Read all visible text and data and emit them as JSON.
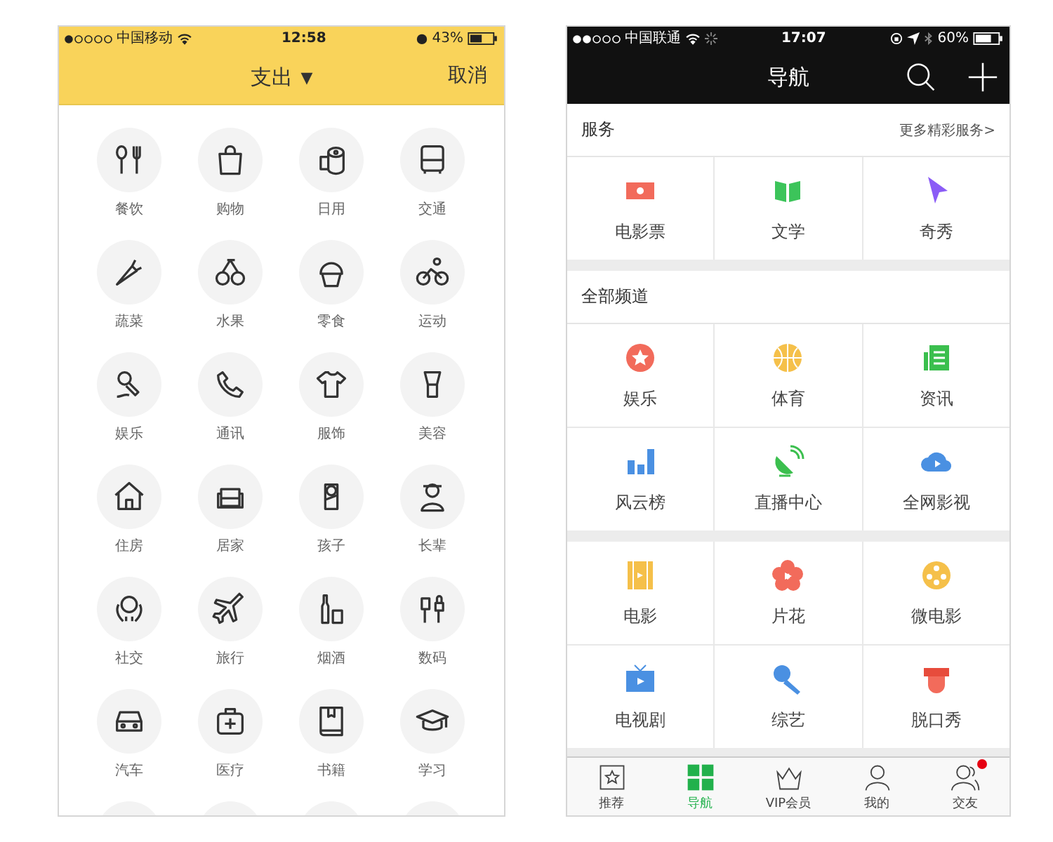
{
  "left_phone": {
    "status_bar": {
      "carrier": "中国移动",
      "time": "12:58",
      "battery": "43%"
    },
    "header": {
      "title": "支出",
      "dropdown_arrow": "▼",
      "cancel": "取消"
    },
    "categories": [
      {
        "label": "餐饮"
      },
      {
        "label": "购物"
      },
      {
        "label": "日用"
      },
      {
        "label": "交通"
      },
      {
        "label": "蔬菜"
      },
      {
        "label": "水果"
      },
      {
        "label": "零食"
      },
      {
        "label": "运动"
      },
      {
        "label": "娱乐"
      },
      {
        "label": "通讯"
      },
      {
        "label": "服饰"
      },
      {
        "label": "美容"
      },
      {
        "label": "住房"
      },
      {
        "label": "居家"
      },
      {
        "label": "孩子"
      },
      {
        "label": "长辈"
      },
      {
        "label": "社交"
      },
      {
        "label": "旅行"
      },
      {
        "label": "烟酒"
      },
      {
        "label": "数码"
      },
      {
        "label": "汽车"
      },
      {
        "label": "医疗"
      },
      {
        "label": "书籍"
      },
      {
        "label": "学习"
      },
      {
        "cut": true
      },
      {
        "cut": true
      },
      {
        "cut": true
      },
      {
        "cut": true
      }
    ]
  },
  "right_phone": {
    "status_bar": {
      "carrier": "中国联通",
      "time": "17:07",
      "battery": "60%"
    },
    "header": {
      "title": "导航"
    },
    "sections": [
      {
        "title": "服务",
        "more": "更多精彩服务>",
        "groups": [
          [
            {
              "label": "电影票"
            },
            {
              "label": "文学"
            },
            {
              "label": "奇秀"
            }
          ]
        ]
      },
      {
        "title": "全部频道",
        "groups": [
          [
            {
              "label": "娱乐"
            },
            {
              "label": "体育"
            },
            {
              "label": "资讯"
            },
            {
              "label": "风云榜"
            },
            {
              "label": "直播中心"
            },
            {
              "label": "全网影视"
            }
          ],
          [
            {
              "label": "电影"
            },
            {
              "label": "片花"
            },
            {
              "label": "微电影"
            },
            {
              "label": "电视剧"
            },
            {
              "label": "综艺"
            },
            {
              "label": "脱口秀"
            }
          ]
        ]
      }
    ],
    "tab_bar": [
      {
        "label": "推荐",
        "selected": false
      },
      {
        "label": "导航",
        "selected": true
      },
      {
        "label": "VIP会员",
        "selected": false
      },
      {
        "label": "我的",
        "selected": false
      },
      {
        "label": "交友",
        "selected": false,
        "dot": true
      }
    ]
  }
}
